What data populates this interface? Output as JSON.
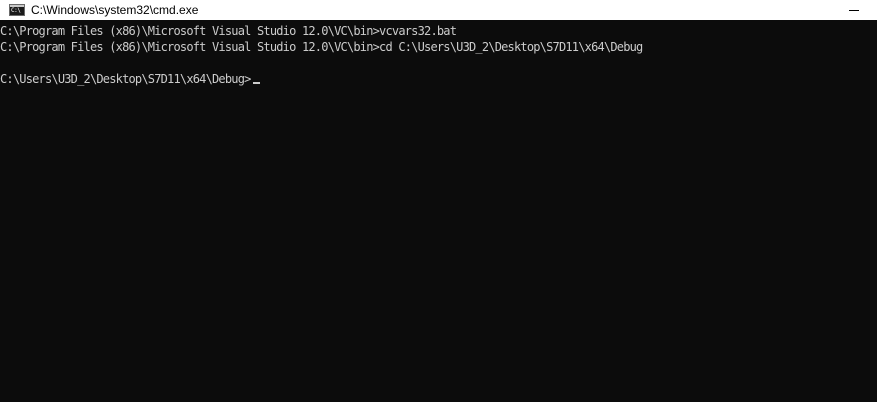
{
  "window": {
    "title": "C:\\Windows\\system32\\cmd.exe",
    "icon": "cmd-icon",
    "icon_glyph": "C:\\"
  },
  "console": {
    "lines": [
      "C:\\Program Files (x86)\\Microsoft Visual Studio 12.0\\VC\\bin>vcvars32.bat",
      "C:\\Program Files (x86)\\Microsoft Visual Studio 12.0\\VC\\bin>cd C:\\Users\\U3D_2\\Desktop\\S7D11\\x64\\Debug",
      "",
      "C:\\Users\\U3D_2\\Desktop\\S7D11\\x64\\Debug>"
    ],
    "background": "#0c0c0c",
    "foreground": "#cccccc"
  }
}
